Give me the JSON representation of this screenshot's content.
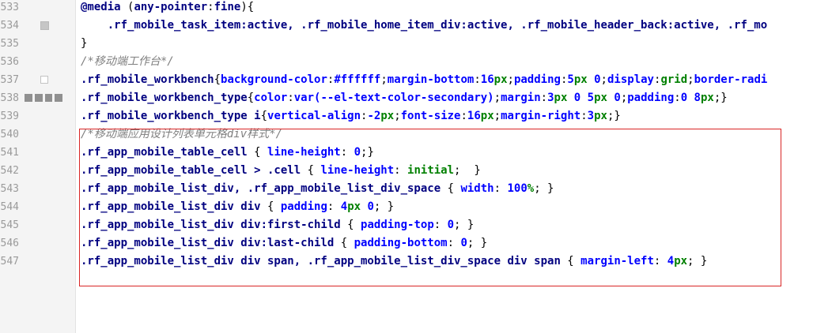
{
  "gutter": {
    "lines": [
      {
        "number": "533",
        "marker": ""
      },
      {
        "number": "534",
        "marker": "small-square"
      },
      {
        "number": "535",
        "marker": ""
      },
      {
        "number": "536",
        "marker": ""
      },
      {
        "number": "537",
        "marker": "hollow-square"
      },
      {
        "number": "538",
        "marker": "bar"
      },
      {
        "number": "539",
        "marker": ""
      },
      {
        "number": "540",
        "marker": ""
      },
      {
        "number": "541",
        "marker": ""
      },
      {
        "number": "542",
        "marker": ""
      },
      {
        "number": "543",
        "marker": ""
      },
      {
        "number": "544",
        "marker": ""
      },
      {
        "number": "545",
        "marker": ""
      },
      {
        "number": "546",
        "marker": ""
      },
      {
        "number": "547",
        "marker": ""
      }
    ]
  },
  "code": {
    "lines": [
      [
        {
          "t": "@media",
          "c": "at"
        },
        {
          "t": " (",
          "c": "punc"
        },
        {
          "t": "any-pointer",
          "c": "kw"
        },
        {
          "t": ":",
          "c": "punc"
        },
        {
          "t": "fine",
          "c": "kw"
        },
        {
          "t": "){",
          "c": "punc"
        }
      ],
      [
        {
          "t": "    .rf_mobile_task_item:active, .rf_mobile_home_item_div:active, .rf_mobile_header_back:active, .rf_mo",
          "c": "sel"
        }
      ],
      [
        {
          "t": "}",
          "c": "punc"
        }
      ],
      [
        {
          "t": "/*移动端工作台*/",
          "c": "cm"
        }
      ],
      [
        {
          "t": ".rf_mobile_workbench",
          "c": "sel"
        },
        {
          "t": "{",
          "c": "punc"
        },
        {
          "t": "background-color",
          "c": "prop"
        },
        {
          "t": ":",
          "c": "punc"
        },
        {
          "t": "#ffffff",
          "c": "val"
        },
        {
          "t": ";",
          "c": "punc"
        },
        {
          "t": "margin-bottom",
          "c": "prop"
        },
        {
          "t": ":",
          "c": "punc"
        },
        {
          "t": "16",
          "c": "num"
        },
        {
          "t": "px",
          "c": "unit"
        },
        {
          "t": ";",
          "c": "punc"
        },
        {
          "t": "padding",
          "c": "prop"
        },
        {
          "t": ":",
          "c": "punc"
        },
        {
          "t": "5",
          "c": "num"
        },
        {
          "t": "px",
          "c": "unit"
        },
        {
          "t": " 0",
          "c": "num"
        },
        {
          "t": ";",
          "c": "punc"
        },
        {
          "t": "display",
          "c": "prop"
        },
        {
          "t": ":",
          "c": "punc"
        },
        {
          "t": "grid",
          "c": "green"
        },
        {
          "t": ";",
          "c": "punc"
        },
        {
          "t": "border-radi",
          "c": "prop"
        }
      ],
      [
        {
          "t": ".rf_mobile_workbench_type",
          "c": "sel"
        },
        {
          "t": "{",
          "c": "punc"
        },
        {
          "t": "color",
          "c": "prop"
        },
        {
          "t": ":",
          "c": "punc"
        },
        {
          "t": "var(--el-text-color-secondary)",
          "c": "val"
        },
        {
          "t": ";",
          "c": "punc"
        },
        {
          "t": "margin",
          "c": "prop"
        },
        {
          "t": ":",
          "c": "punc"
        },
        {
          "t": "3",
          "c": "num"
        },
        {
          "t": "px",
          "c": "unit"
        },
        {
          "t": " 0 5",
          "c": "num"
        },
        {
          "t": "px",
          "c": "unit"
        },
        {
          "t": " 0",
          "c": "num"
        },
        {
          "t": ";",
          "c": "punc"
        },
        {
          "t": "padding",
          "c": "prop"
        },
        {
          "t": ":",
          "c": "punc"
        },
        {
          "t": "0 8",
          "c": "num"
        },
        {
          "t": "px",
          "c": "unit"
        },
        {
          "t": ";}",
          "c": "punc"
        }
      ],
      [
        {
          "t": ".rf_mobile_workbench_type i",
          "c": "sel"
        },
        {
          "t": "{",
          "c": "punc"
        },
        {
          "t": "vertical-align",
          "c": "prop"
        },
        {
          "t": ":",
          "c": "punc"
        },
        {
          "t": "-2",
          "c": "num"
        },
        {
          "t": "px",
          "c": "unit"
        },
        {
          "t": ";",
          "c": "punc"
        },
        {
          "t": "font-size",
          "c": "prop"
        },
        {
          "t": ":",
          "c": "punc"
        },
        {
          "t": "16",
          "c": "num"
        },
        {
          "t": "px",
          "c": "unit"
        },
        {
          "t": ";",
          "c": "punc"
        },
        {
          "t": "margin-right",
          "c": "prop"
        },
        {
          "t": ":",
          "c": "punc"
        },
        {
          "t": "3",
          "c": "num"
        },
        {
          "t": "px",
          "c": "unit"
        },
        {
          "t": ";}",
          "c": "punc"
        }
      ],
      [
        {
          "t": "/*移动端应用设计列表单元格div样式*/",
          "c": "cm"
        }
      ],
      [
        {
          "t": ".rf_app_mobile_table_cell",
          "c": "sel"
        },
        {
          "t": " { ",
          "c": "punc"
        },
        {
          "t": "line-height",
          "c": "prop"
        },
        {
          "t": ": ",
          "c": "punc"
        },
        {
          "t": "0",
          "c": "num"
        },
        {
          "t": ";}",
          "c": "punc"
        }
      ],
      [
        {
          "t": ".rf_app_mobile_table_cell > .cell",
          "c": "sel"
        },
        {
          "t": " { ",
          "c": "punc"
        },
        {
          "t": "line-height",
          "c": "prop"
        },
        {
          "t": ": ",
          "c": "punc"
        },
        {
          "t": "initial",
          "c": "green"
        },
        {
          "t": ";  }",
          "c": "punc"
        }
      ],
      [
        {
          "t": ".rf_app_mobile_list_div, .rf_app_mobile_list_div_space",
          "c": "sel"
        },
        {
          "t": " { ",
          "c": "punc"
        },
        {
          "t": "width",
          "c": "prop"
        },
        {
          "t": ": ",
          "c": "punc"
        },
        {
          "t": "100",
          "c": "num"
        },
        {
          "t": "%",
          "c": "unit"
        },
        {
          "t": "; }",
          "c": "punc"
        }
      ],
      [
        {
          "t": ".rf_app_mobile_list_div div",
          "c": "sel"
        },
        {
          "t": " { ",
          "c": "punc"
        },
        {
          "t": "padding",
          "c": "prop"
        },
        {
          "t": ": ",
          "c": "punc"
        },
        {
          "t": "4",
          "c": "num"
        },
        {
          "t": "px",
          "c": "unit"
        },
        {
          "t": " 0",
          "c": "num"
        },
        {
          "t": "; }",
          "c": "punc"
        }
      ],
      [
        {
          "t": ".rf_app_mobile_list_div div:first-child",
          "c": "sel"
        },
        {
          "t": " { ",
          "c": "punc"
        },
        {
          "t": "padding-top",
          "c": "prop"
        },
        {
          "t": ": ",
          "c": "punc"
        },
        {
          "t": "0",
          "c": "num"
        },
        {
          "t": "; }",
          "c": "punc"
        }
      ],
      [
        {
          "t": ".rf_app_mobile_list_div div:last-child",
          "c": "sel"
        },
        {
          "t": " { ",
          "c": "punc"
        },
        {
          "t": "padding-bottom",
          "c": "prop"
        },
        {
          "t": ": ",
          "c": "punc"
        },
        {
          "t": "0",
          "c": "num"
        },
        {
          "t": "; }",
          "c": "punc"
        }
      ],
      [
        {
          "t": ".rf_app_mobile_list_div div span, .rf_app_mobile_list_div_space div span",
          "c": "sel"
        },
        {
          "t": " { ",
          "c": "punc"
        },
        {
          "t": "margin-left",
          "c": "prop"
        },
        {
          "t": ": ",
          "c": "punc"
        },
        {
          "t": "4",
          "c": "num"
        },
        {
          "t": "px",
          "c": "unit"
        },
        {
          "t": "; }",
          "c": "punc"
        }
      ]
    ]
  },
  "highlight": {
    "color": "#d92626"
  }
}
